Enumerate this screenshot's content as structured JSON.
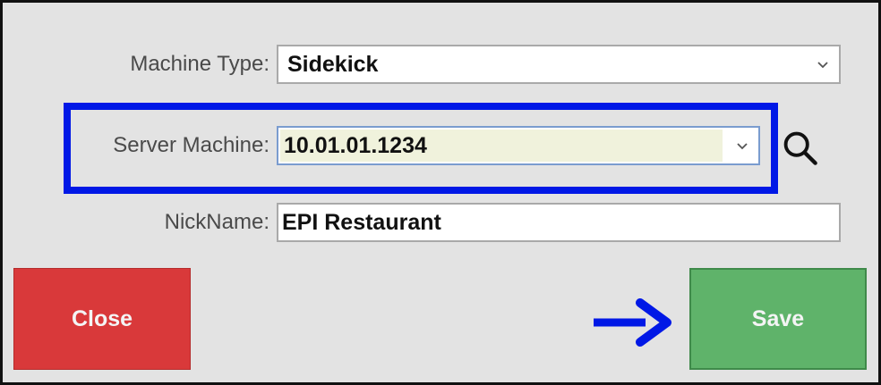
{
  "form": {
    "machine_type": {
      "label": "Machine Type:",
      "value": "Sidekick"
    },
    "server_machine": {
      "label": "Server Machine:",
      "value": "10.01.01.1234",
      "field_highlight_color": "#f0f2dc"
    },
    "nickname": {
      "label": "NickName:",
      "value": "EPI Restaurant"
    }
  },
  "buttons": {
    "close_label": "Close",
    "save_label": "Save"
  },
  "colors": {
    "close_button": "#d9393a",
    "save_button": "#5fb36a",
    "annotation_blue": "#0018e6"
  },
  "icons": {
    "search": "search-icon",
    "dropdown": "chevron-down-icon",
    "annotation_arrow": "arrow-right-icon"
  }
}
